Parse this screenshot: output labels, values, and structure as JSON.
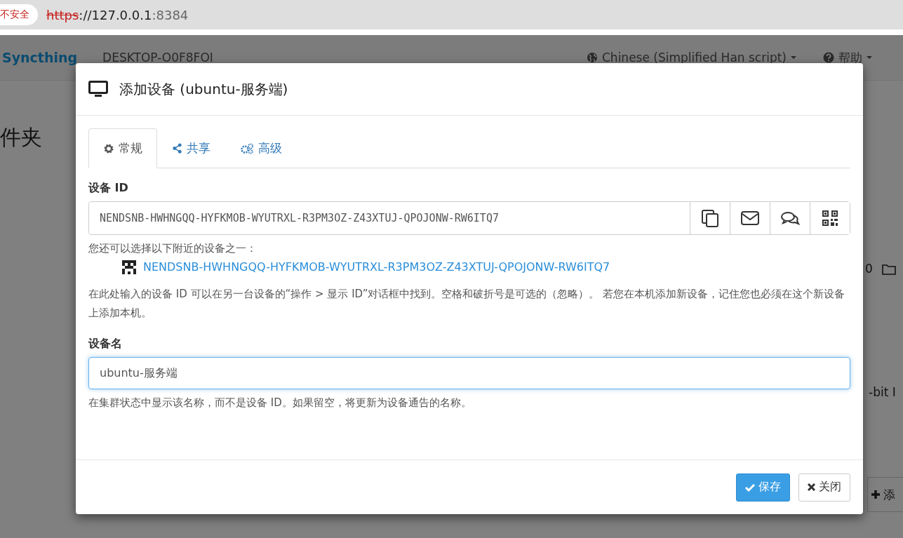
{
  "browser": {
    "security": "不安全",
    "url_scheme": "https",
    "url_host": "://127.0.0.1",
    "url_port": ":8384"
  },
  "navbar": {
    "brand": "Syncthing",
    "device": "DESKTOP-O0F8FOI",
    "language": "Chinese (Simplified Han script)",
    "help": "帮助"
  },
  "background": {
    "heading": "件夹",
    "count": "0",
    "os_text": "-bit I",
    "add_button": "添"
  },
  "dialog": {
    "title": "添加设备 (ubuntu-服务端)",
    "tabs": [
      {
        "label": "常规",
        "selected": true
      },
      {
        "label": "共享",
        "selected": false
      },
      {
        "label": "高级",
        "selected": false
      }
    ],
    "device_id_label": "设备 ID",
    "device_id_value": "NENDSNB-HWHNGQQ-HYFKMOB-WYUTRXL-R3PM3OZ-Z43XTUJ-QPOJONW-RW6ITQ7",
    "id_actions": [
      {
        "kind": "copy"
      },
      {
        "kind": "mail"
      },
      {
        "kind": "chat"
      },
      {
        "kind": "qr"
      }
    ],
    "nearby_hint": "您还可以选择以下附近的设备之一：",
    "nearby_devices": [
      "NENDSNB-HWHNGQQ-HYFKMOB-WYUTRXL-R3PM3OZ-Z43XTUJ-QPOJONW-RW6ITQ7"
    ],
    "id_help": "在此处输入的设备 ID 可以在另一台设备的“操作 > 显示 ID”对话框中找到。空格和破折号是可选的（忽略）。 若您在本机添加新设备，记住您也必须在这个新设备上添加本机。",
    "name_label": "设备名",
    "name_value": "ubuntu-服务端",
    "name_focused": true,
    "name_help": "在集群状态中显示该名称，而不是设备 ID。如果留空，将更新为设备通告的名称。",
    "buttons": [
      {
        "label": "保存",
        "kind": "primary"
      },
      {
        "label": "关闭",
        "kind": "close"
      }
    ]
  }
}
